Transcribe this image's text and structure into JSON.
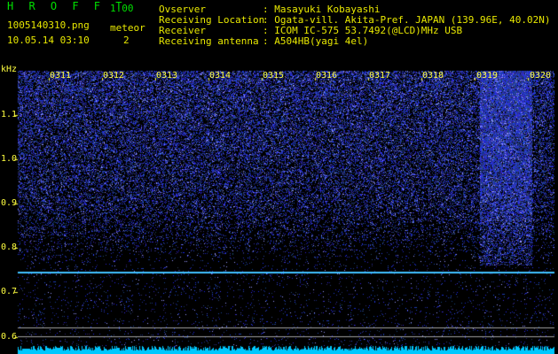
{
  "header": {
    "brand": "H R O F F T",
    "version": "1.00",
    "filename": "1005140310.png",
    "event_label": "meteor",
    "datetime": "10.05.14 03:10",
    "event_count": "2"
  },
  "station": {
    "rows": [
      {
        "key": "Ovserver",
        "value": ": Masayuki Kobayashi"
      },
      {
        "key": "Receiving Location",
        "value": ": Ogata-vill. Akita-Pref. JAPAN (139.96E, 40.02N)"
      },
      {
        "key": "Receiver",
        "value": ": ICOM IC-575 53.7492(@LCD)MHz USB"
      },
      {
        "key": "Receiving antenna",
        "value": ": A504HB(yagi 4el)"
      }
    ]
  },
  "spectrogram": {
    "y_unit": "kHz",
    "y_ticks": [
      "1.1",
      "1.0",
      "0.9",
      "0.8",
      "0.7",
      "0.6"
    ],
    "time_ticks": [
      "0311",
      "0312",
      "0313",
      "0314",
      "0315",
      "0316",
      "0317",
      "0318",
      "0319",
      "0320"
    ],
    "colors": {
      "text": "#ffff40",
      "noise": "#2030c0",
      "carrier": "#40c0ff",
      "baseline": "#00c8ff"
    }
  }
}
